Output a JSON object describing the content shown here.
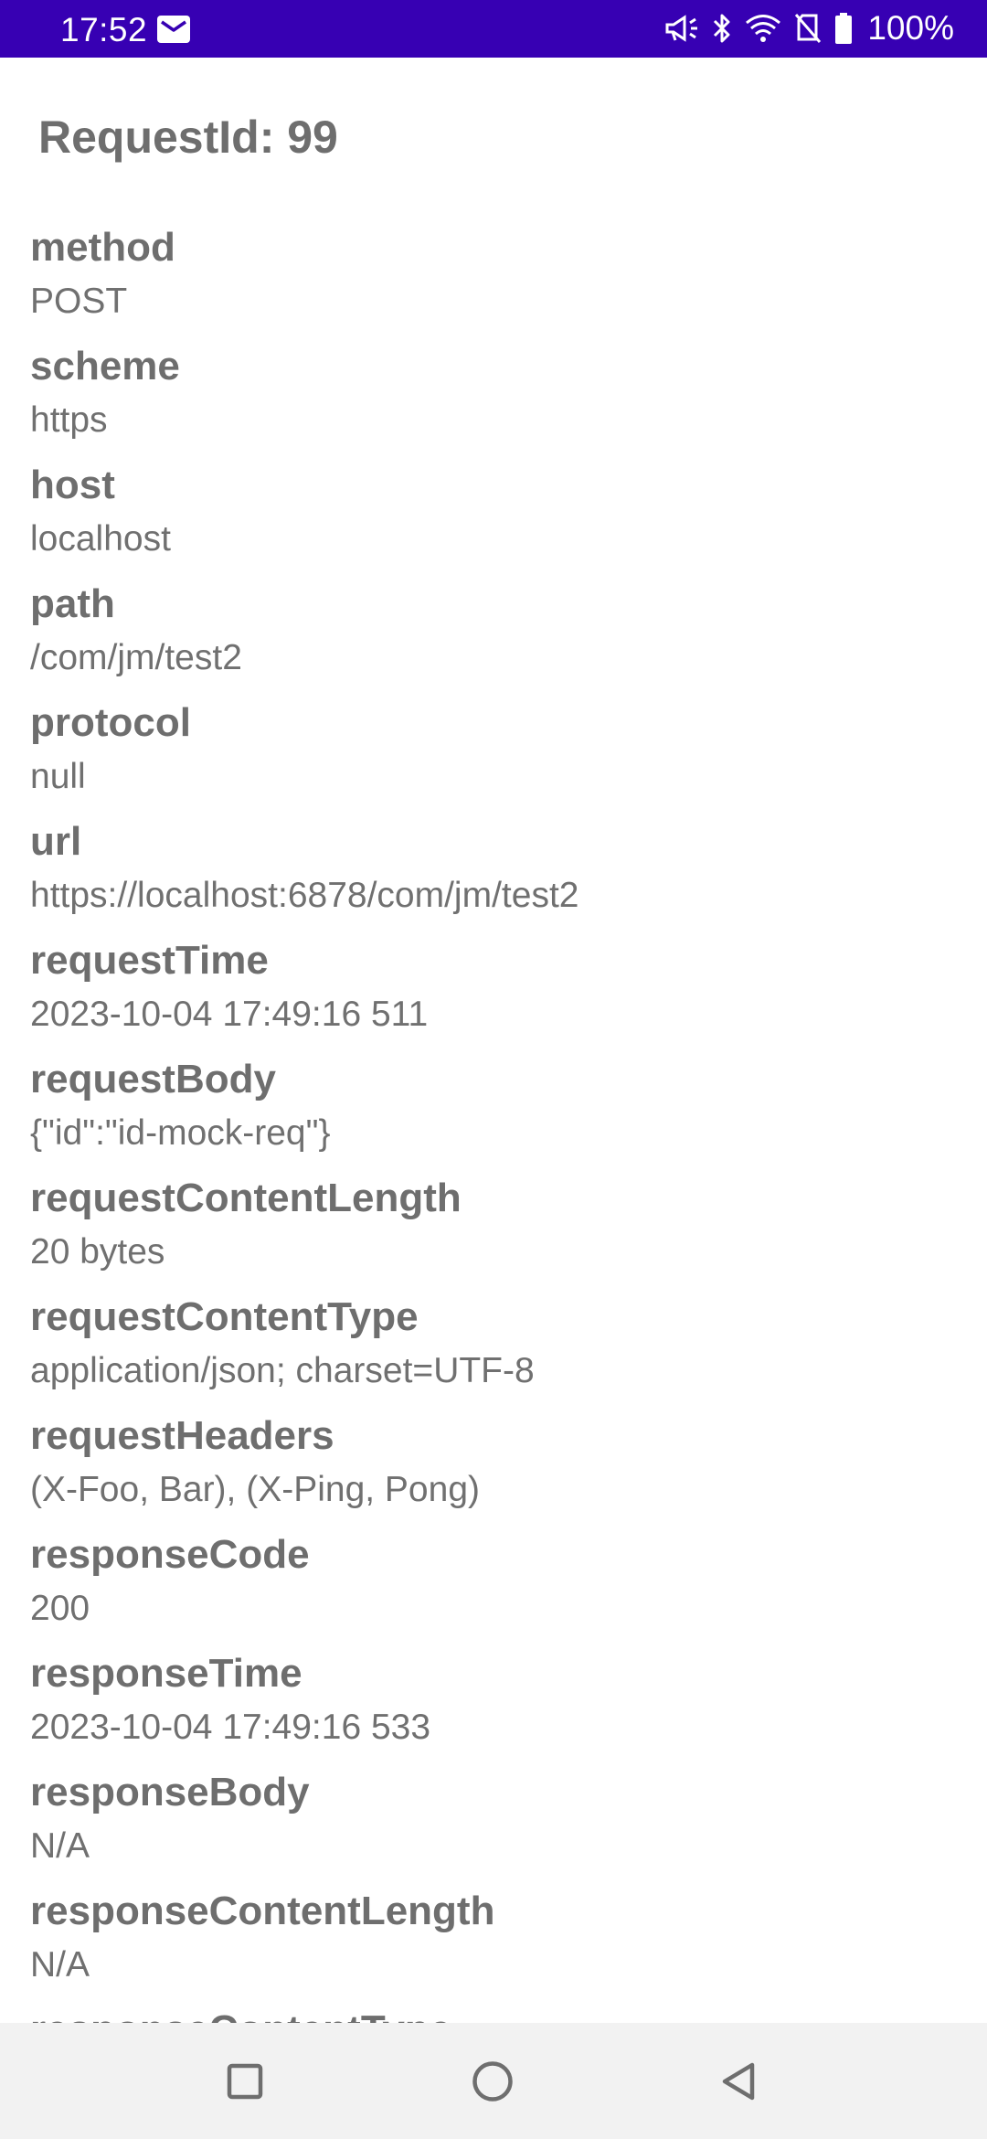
{
  "status_bar": {
    "time": "17:52",
    "battery": "100%",
    "icons": [
      "mail-icon",
      "megaphone-icon",
      "bluetooth-icon",
      "wifi-icon",
      "no-sim-icon",
      "battery-icon"
    ],
    "color": "#3700b3"
  },
  "page": {
    "title": "RequestId: 99"
  },
  "fields": [
    {
      "label": "method",
      "value": "POST"
    },
    {
      "label": "scheme",
      "value": "https"
    },
    {
      "label": "host",
      "value": "localhost"
    },
    {
      "label": "path",
      "value": "/com/jm/test2"
    },
    {
      "label": "protocol",
      "value": "null"
    },
    {
      "label": "url",
      "value": "https://localhost:6878/com/jm/test2"
    },
    {
      "label": "requestTime",
      "value": "2023-10-04 17:49:16 511"
    },
    {
      "label": "requestBody",
      "value": "{\"id\":\"id-mock-req\"}"
    },
    {
      "label": "requestContentLength",
      "value": "20 bytes"
    },
    {
      "label": "requestContentType",
      "value": "application/json; charset=UTF-8"
    },
    {
      "label": "requestHeaders",
      "value": "(X-Foo, Bar), (X-Ping, Pong)"
    },
    {
      "label": "responseCode",
      "value": "200"
    },
    {
      "label": "responseTime",
      "value": "2023-10-04 17:49:16 533"
    },
    {
      "label": "responseBody",
      "value": "N/A"
    },
    {
      "label": "responseContentLength",
      "value": "N/A"
    },
    {
      "label": "responseContentType",
      "value": ""
    }
  ],
  "nav_bar": {
    "buttons": [
      "recents-square-icon",
      "home-circle-icon",
      "back-triangle-icon"
    ]
  }
}
